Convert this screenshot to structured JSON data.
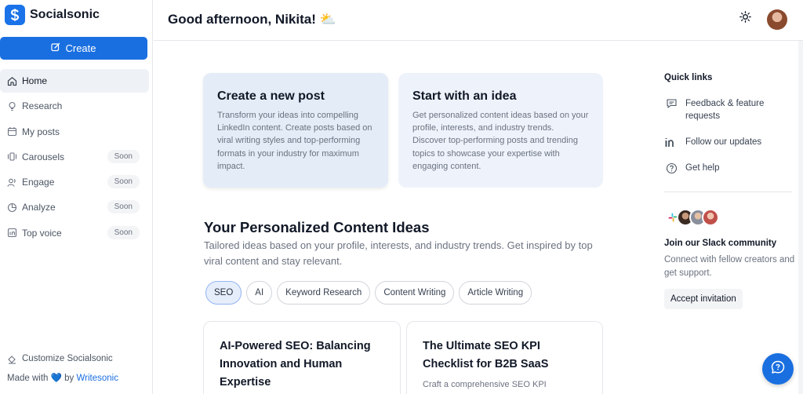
{
  "brand": {
    "name": "Socialsonic"
  },
  "sidebar": {
    "create_label": "Create",
    "items": [
      {
        "label": "Home",
        "icon": "home-icon",
        "badge": ""
      },
      {
        "label": "Research",
        "icon": "lightbulb-icon",
        "badge": ""
      },
      {
        "label": "My posts",
        "icon": "calendar-icon",
        "badge": ""
      },
      {
        "label": "Carousels",
        "icon": "carousel-icon",
        "badge": "Soon"
      },
      {
        "label": "Engage",
        "icon": "users-icon",
        "badge": "Soon"
      },
      {
        "label": "Analyze",
        "icon": "pie-chart-icon",
        "badge": "Soon"
      },
      {
        "label": "Top voice",
        "icon": "linkedin-icon",
        "badge": "Soon"
      }
    ],
    "customize_label": "Customize Socialsonic",
    "made_with_prefix": "Made with",
    "made_with_by": "by",
    "made_with_link": "Writesonic"
  },
  "header": {
    "greeting": "Good afternoon, Nikita!",
    "greeting_emoji": "⛅"
  },
  "cards": {
    "create": {
      "title": "Create a new post",
      "desc": "Transform your ideas into compelling LinkedIn content. Create posts based on viral writing styles and top-performing formats in your industry for maximum impact."
    },
    "idea": {
      "title": "Start with an idea",
      "desc": "Get personalized content ideas based on your profile, interests, and industry trends. Discover top-performing posts and trending topics to showcase your expertise with engaging content."
    }
  },
  "ideas_section": {
    "title": "Your Personalized Content Ideas",
    "subtitle": "Tailored ideas based on your profile, interests, and industry trends. Get inspired by top viral content and stay relevant.",
    "chips": [
      "SEO",
      "AI",
      "Keyword Research",
      "Content Writing",
      "Article Writing"
    ],
    "cards": [
      {
        "title": "AI-Powered SEO: Balancing Innovation and Human Expertise",
        "desc": ""
      },
      {
        "title": "The Ultimate SEO KPI Checklist for B2B SaaS",
        "desc": "Craft a comprehensive SEO KPI"
      }
    ]
  },
  "quick_links": {
    "title": "Quick links",
    "items": [
      {
        "label": "Feedback & feature requests",
        "icon": "message-icon"
      },
      {
        "label": "Follow our updates",
        "icon": "linkedin-icon"
      },
      {
        "label": "Get help",
        "icon": "help-circle-icon"
      }
    ]
  },
  "slack": {
    "title": "Join our Slack community",
    "desc": "Connect with fellow creators and get support.",
    "button": "Accept invitation"
  },
  "colors": {
    "accent": "#1a6fe0",
    "card_highlight": "#e4ecf7",
    "card_light": "#eef3fb"
  }
}
